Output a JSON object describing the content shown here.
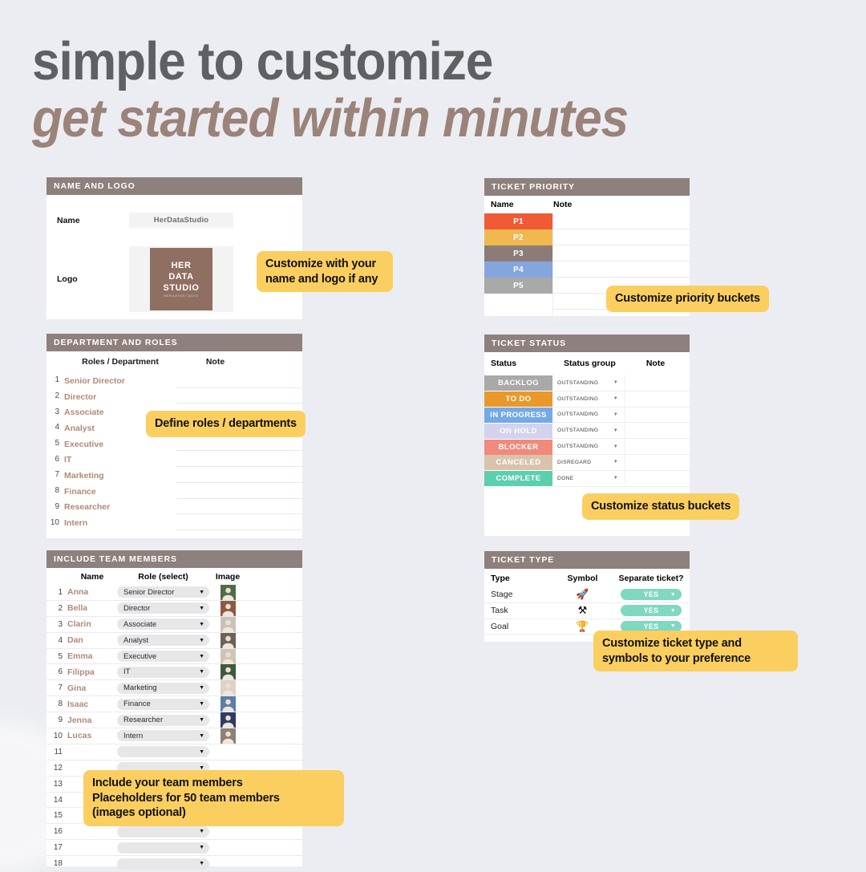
{
  "headline": {
    "line1": "simple to customize",
    "line2": "get started within minutes"
  },
  "colors": {
    "background": "#ecedf2",
    "panel_header": "#8e807c",
    "headline_primary": "#5f6064",
    "headline_accent": "#9b8379",
    "callout": "#fbcf5f",
    "name_accent": "#b08a77",
    "logo_brown": "#8f6f62",
    "yes_teal": "#7fd8bf"
  },
  "panels": {
    "name_logo": {
      "title": "NAME AND LOGO",
      "rows": [
        {
          "label": "Name",
          "value": "HerDataStudio"
        },
        {
          "label": "Logo",
          "value": ""
        }
      ],
      "logo": {
        "line1": "HER",
        "line2": "DATA",
        "line3": "STUDIO",
        "tagline": "HERDATASTUDIO"
      }
    },
    "department_roles": {
      "title": "DEPARTMENT AND ROLES",
      "columns": [
        "Roles / Department",
        "Note"
      ],
      "rows": [
        {
          "num": "1",
          "role": "Senior Director",
          "note": ""
        },
        {
          "num": "2",
          "role": "Director",
          "note": ""
        },
        {
          "num": "3",
          "role": "Associate",
          "note": ""
        },
        {
          "num": "4",
          "role": "Analyst",
          "note": ""
        },
        {
          "num": "5",
          "role": "Executive",
          "note": ""
        },
        {
          "num": "6",
          "role": "IT",
          "note": ""
        },
        {
          "num": "7",
          "role": "Marketing",
          "note": ""
        },
        {
          "num": "8",
          "role": "Finance",
          "note": ""
        },
        {
          "num": "9",
          "role": "Researcher",
          "note": ""
        },
        {
          "num": "10",
          "role": "Intern",
          "note": ""
        }
      ]
    },
    "team_members": {
      "title": "INCLUDE TEAM MEMBERS",
      "columns": [
        "Name",
        "Role (select)",
        "Image"
      ],
      "rows": [
        {
          "num": "1",
          "name": "Anna",
          "role": "Senior Director",
          "has_image": true
        },
        {
          "num": "2",
          "name": "Bella",
          "role": "Director",
          "has_image": true
        },
        {
          "num": "3",
          "name": "Clarin",
          "role": "Associate",
          "has_image": true
        },
        {
          "num": "4",
          "name": "Dan",
          "role": "Analyst",
          "has_image": true
        },
        {
          "num": "5",
          "name": "Emma",
          "role": "Executive",
          "has_image": true
        },
        {
          "num": "6",
          "name": "Filippa",
          "role": "IT",
          "has_image": true
        },
        {
          "num": "7",
          "name": "Gina",
          "role": "Marketing",
          "has_image": true
        },
        {
          "num": "8",
          "name": "Isaac",
          "role": "Finance",
          "has_image": true
        },
        {
          "num": "9",
          "name": "Jenna",
          "role": "Researcher",
          "has_image": true
        },
        {
          "num": "10",
          "name": "Lucas",
          "role": "Intern",
          "has_image": true
        },
        {
          "num": "11",
          "name": "",
          "role": "",
          "has_image": false
        },
        {
          "num": "12",
          "name": "",
          "role": "",
          "has_image": false
        },
        {
          "num": "13",
          "name": "",
          "role": "",
          "has_image": false
        },
        {
          "num": "14",
          "name": "",
          "role": "",
          "has_image": false
        },
        {
          "num": "15",
          "name": "",
          "role": "",
          "has_image": false
        },
        {
          "num": "16",
          "name": "",
          "role": "",
          "has_image": false
        },
        {
          "num": "17",
          "name": "",
          "role": "",
          "has_image": false
        },
        {
          "num": "18",
          "name": "",
          "role": "",
          "has_image": false
        }
      ]
    },
    "ticket_priority": {
      "title": "TICKET PRIORITY",
      "columns": [
        "Name",
        "Note"
      ],
      "rows": [
        {
          "name": "P1",
          "color": "#f05a35",
          "note": ""
        },
        {
          "name": "P2",
          "color": "#f0b950",
          "note": ""
        },
        {
          "name": "P3",
          "color": "#8b7c78",
          "note": ""
        },
        {
          "name": "P4",
          "color": "#85a5de",
          "note": ""
        },
        {
          "name": "P5",
          "color": "#a9a9a9",
          "note": ""
        }
      ]
    },
    "ticket_status": {
      "title": "TICKET STATUS",
      "columns": [
        "Status",
        "Status group",
        "Note"
      ],
      "rows": [
        {
          "status": "BACKLOG",
          "color": "#a9a9a9",
          "group": "OUTSTANDING",
          "note": ""
        },
        {
          "status": "TO DO",
          "color": "#e8992a",
          "group": "OUTSTANDING",
          "note": ""
        },
        {
          "status": "IN PROGRESS",
          "color": "#74a9e8",
          "group": "OUTSTANDING",
          "note": ""
        },
        {
          "status": "ON HOLD",
          "color": "#d3d3ee",
          "group": "OUTSTANDING",
          "note": ""
        },
        {
          "status": "BLOCKER",
          "color": "#f08a7a",
          "group": "OUTSTANDING",
          "note": ""
        },
        {
          "status": "CANCELED",
          "color": "#d9c3ac",
          "group": "DISREGARD",
          "note": ""
        },
        {
          "status": "COMPLETE",
          "color": "#5ccfae",
          "group": "DONE",
          "note": ""
        }
      ]
    },
    "ticket_type": {
      "title": "TICKET TYPE",
      "columns": [
        "Type",
        "Symbol",
        "Separate ticket?"
      ],
      "rows": [
        {
          "type": "Stage",
          "symbol": "🚀",
          "separate": "YES"
        },
        {
          "type": "Task",
          "symbol": "⚒",
          "separate": "YES"
        },
        {
          "type": "Goal",
          "symbol": "🏆",
          "separate": "YES"
        }
      ]
    }
  },
  "callouts": {
    "name_logo": "Customize with your name and logo if any",
    "roles": "Define roles / departments",
    "team": "Include your team members Placeholders for 50 team members (images optional)",
    "team_l1": "Include your team members",
    "team_l2": "Placeholders for 50 team members",
    "team_l3": "(images optional)",
    "priority": "Customize priority buckets",
    "status": "Customize status buckets",
    "type_l1": "Customize ticket type and",
    "type_l2": "symbols to your preference"
  }
}
